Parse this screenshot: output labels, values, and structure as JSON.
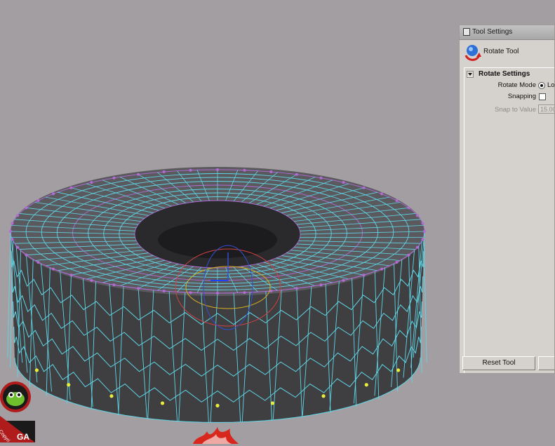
{
  "panel": {
    "title": "Tool Settings",
    "tool_name": "Rotate Tool",
    "section_title": "Rotate Settings",
    "rotate_mode_label": "Rotate Mode",
    "rotate_mode_value": "Lo",
    "snapping_label": "Snapping",
    "snapping_checked": false,
    "snap_value_label": "Snap to Value",
    "snap_value": "15.00",
    "reset_label": "Reset Tool"
  },
  "viewport": {
    "object": "tire-torus-mesh",
    "background_color": "#a39ea2",
    "wire_color": "#5fd6e6",
    "edge_color": "#b36bd6",
    "highlight_vertex_color": "#e8ec3a"
  },
  "watermark": {
    "logo_icon": "mascot-logo-icon",
    "text_fragment": "Copyri",
    "brand_fragment": "GA"
  }
}
